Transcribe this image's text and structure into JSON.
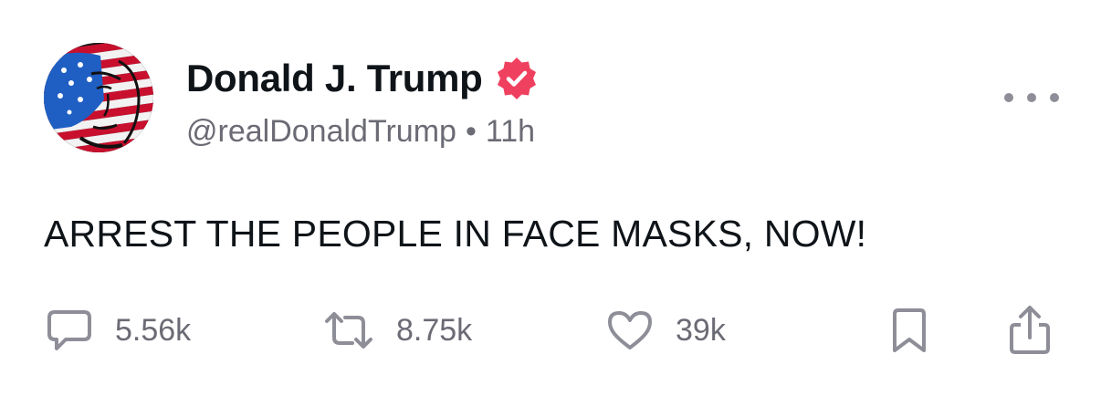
{
  "author": {
    "display_name": "Donald J. Trump",
    "handle": "@realDonaldTrump",
    "separator": "•",
    "time": "11h",
    "verified": true
  },
  "post": {
    "text": "ARREST THE PEOPLE IN FACE MASKS, NOW!"
  },
  "actions": {
    "reply_count": "5.56k",
    "repost_count": "8.75k",
    "like_count": "39k"
  },
  "icons": {
    "avatar": "flag-portrait-avatar",
    "verified": "verified-badge-icon",
    "more": "more-options-icon",
    "reply": "reply-bubble-icon",
    "repost": "repost-arrows-icon",
    "like": "heart-icon",
    "bookmark": "bookmark-icon",
    "share": "share-icon"
  },
  "colors": {
    "text_primary": "#0f1419",
    "text_secondary": "#6b6b75",
    "verified_badge": "#f0405f",
    "icon_gray": "#8e8e98",
    "background": "#ffffff"
  }
}
